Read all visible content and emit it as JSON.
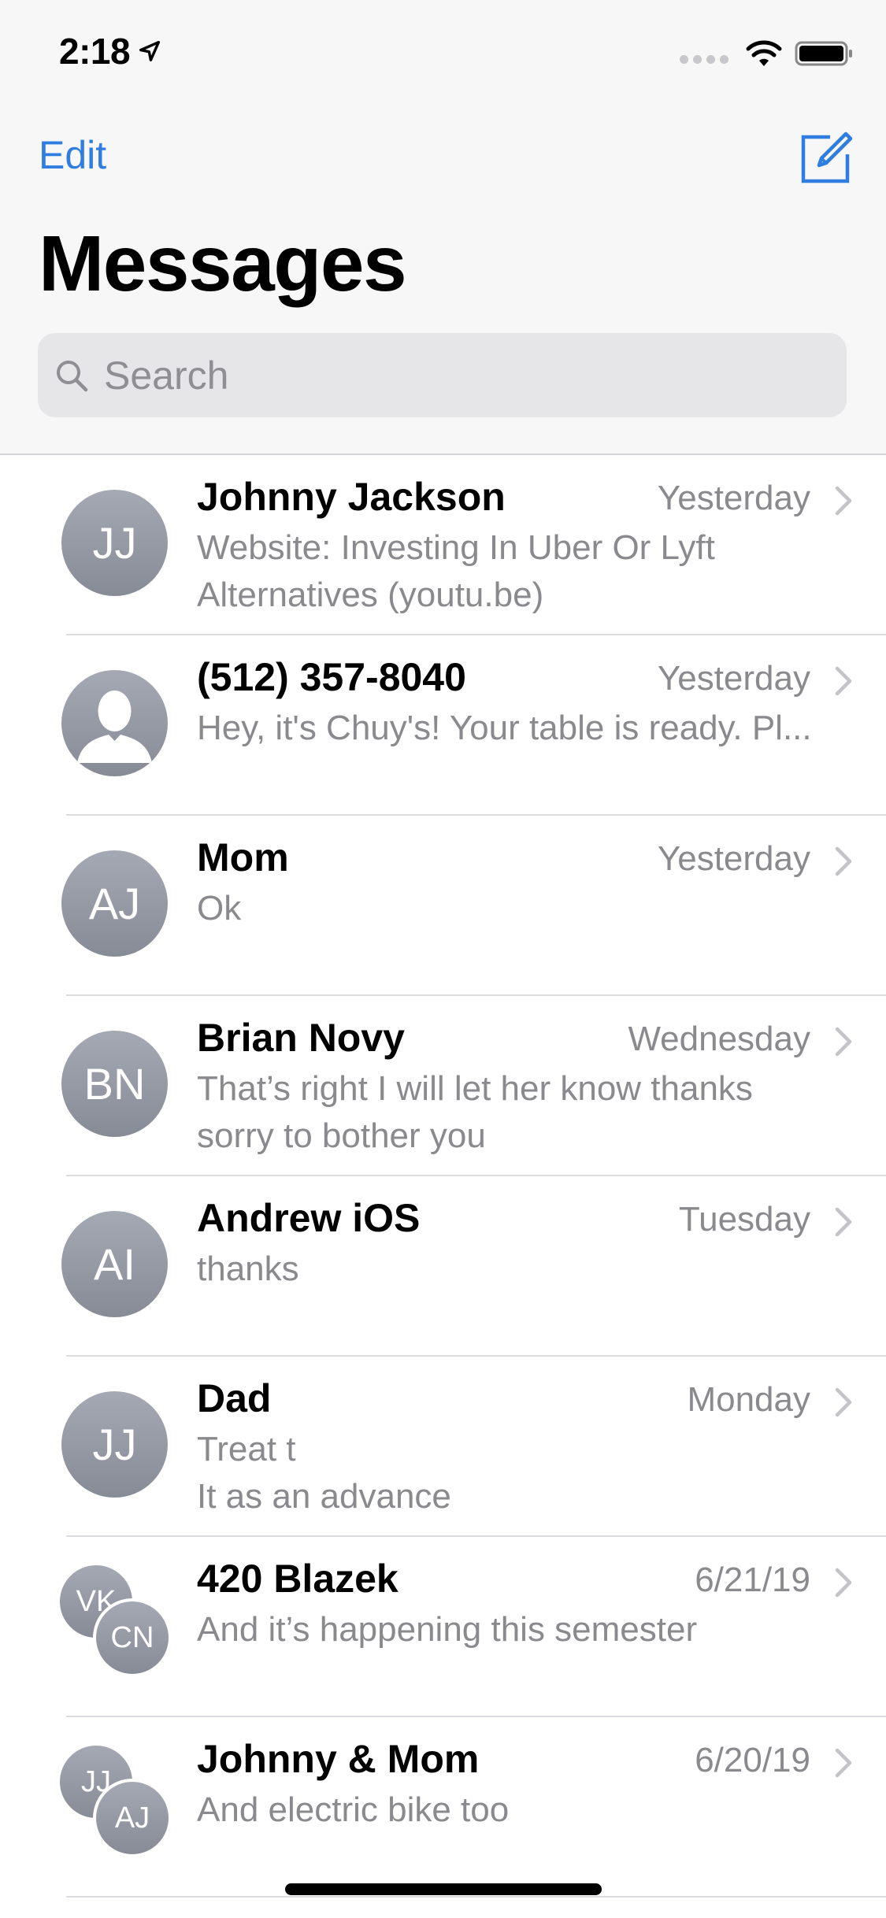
{
  "status_bar": {
    "time": "2:18"
  },
  "nav": {
    "edit_label": "Edit",
    "title": "Messages"
  },
  "search": {
    "placeholder": "Search"
  },
  "conversations": [
    {
      "name": "Johnny Jackson",
      "time": "Yesterday",
      "preview": "Website: Investing In Uber Or Lyft\nAlternatives (youtu.be)",
      "avatar_initials": "JJ"
    },
    {
      "name": "(512) 357-8040",
      "time": "Yesterday",
      "preview": "Hey, it's Chuy's! Your table is ready. Pl...",
      "avatar_initials": ""
    },
    {
      "name": "Mom",
      "time": "Yesterday",
      "preview": "Ok",
      "avatar_initials": "AJ"
    },
    {
      "name": "Brian Novy",
      "time": "Wednesday",
      "preview": "That’s right I will let her know thanks\nsorry to bother you",
      "avatar_initials": "BN"
    },
    {
      "name": "Andrew iOS",
      "time": "Tuesday",
      "preview": "thanks",
      "avatar_initials": "AI"
    },
    {
      "name": "Dad",
      "time": "Monday",
      "preview": "Treat t\nIt as an advance",
      "avatar_initials": "JJ"
    },
    {
      "name": "420 Blazek",
      "time": "6/21/19",
      "preview": "And it’s happening this semester",
      "avatar_initials": [
        "VK",
        "CN"
      ]
    },
    {
      "name": "Johnny & Mom",
      "time": "6/20/19",
      "preview": "And electric bike too",
      "avatar_initials": [
        "JJ",
        "AJ"
      ]
    }
  ],
  "colors": {
    "accent": "#2f7de1",
    "secondary_text": "#8a8a8e",
    "avatar_gray": "#979ba5"
  },
  "icons": [
    "location-arrow-icon",
    "wifi-icon",
    "battery-icon",
    "compose-icon",
    "search-icon",
    "chevron-right-icon",
    "contact-silhouette-icon"
  ]
}
